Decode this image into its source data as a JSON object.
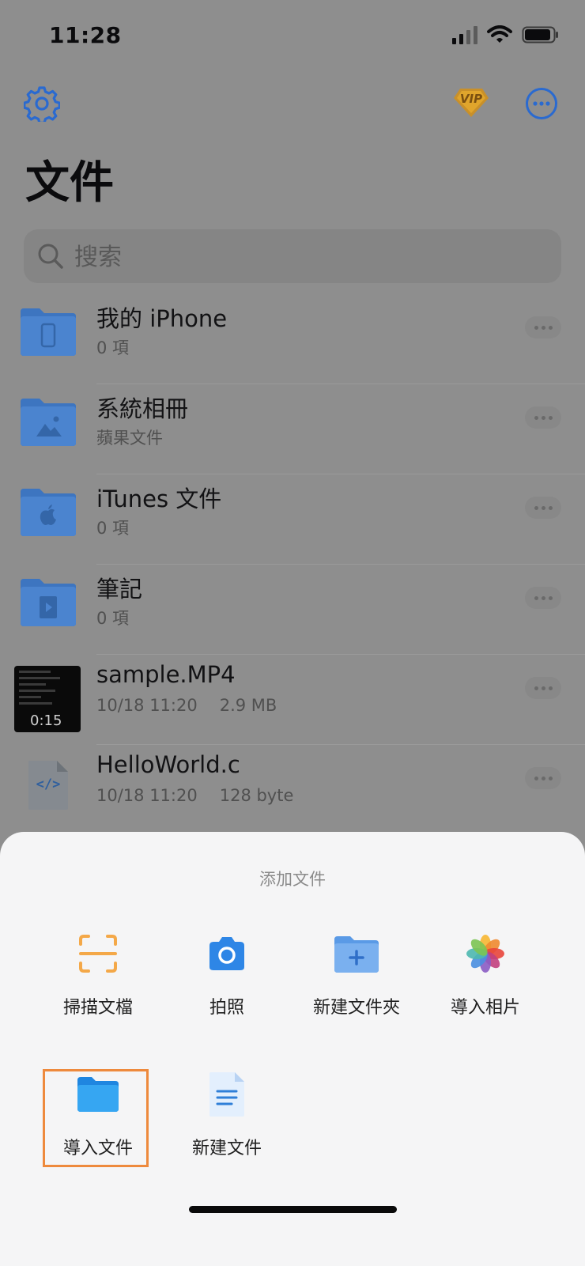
{
  "status_bar": {
    "time": "11:28",
    "icons": [
      "signal-icon",
      "wifi-icon",
      "battery-icon"
    ]
  },
  "header": {
    "title": "文件",
    "vip_label": "VIP",
    "icons": {
      "settings": "gear-icon",
      "vip": "vip-badge-icon",
      "more": "more-icon"
    }
  },
  "search": {
    "placeholder": "搜索",
    "icon": "search-icon"
  },
  "files": [
    {
      "name": "我的 iPhone",
      "meta": "0 項",
      "type": "folder-iphone"
    },
    {
      "name": "系統相冊",
      "meta": "蘋果文件",
      "type": "folder-photos"
    },
    {
      "name": "iTunes 文件",
      "meta": "0 項",
      "type": "folder-apple"
    },
    {
      "name": "筆記",
      "meta": "0 項",
      "type": "folder-notes"
    },
    {
      "name": "sample.MP4",
      "date": "10/18 11:20",
      "size": "2.9 MB",
      "duration": "0:15",
      "type": "video"
    },
    {
      "name": "HelloWorld.c",
      "date": "10/18 11:20",
      "size": "128 byte",
      "type": "code",
      "code_glyph": "</>"
    }
  ],
  "sheet": {
    "title": "添加文件",
    "actions": [
      {
        "label": "掃描文檔",
        "icon": "scan-icon"
      },
      {
        "label": "拍照",
        "icon": "camera-icon"
      },
      {
        "label": "新建文件夾",
        "icon": "new-folder-icon"
      },
      {
        "label": "導入相片",
        "icon": "photos-icon"
      },
      {
        "label": "導入文件",
        "icon": "import-folder-icon",
        "highlighted": true
      },
      {
        "label": "新建文件",
        "icon": "new-document-icon"
      }
    ]
  },
  "colors": {
    "accent": "#2a74d8",
    "vip_gold": "#e0a52c",
    "folder_blue": "#3f7ccb",
    "highlight_orange": "#ee8a3d",
    "scan_orange": "#f4a848"
  }
}
